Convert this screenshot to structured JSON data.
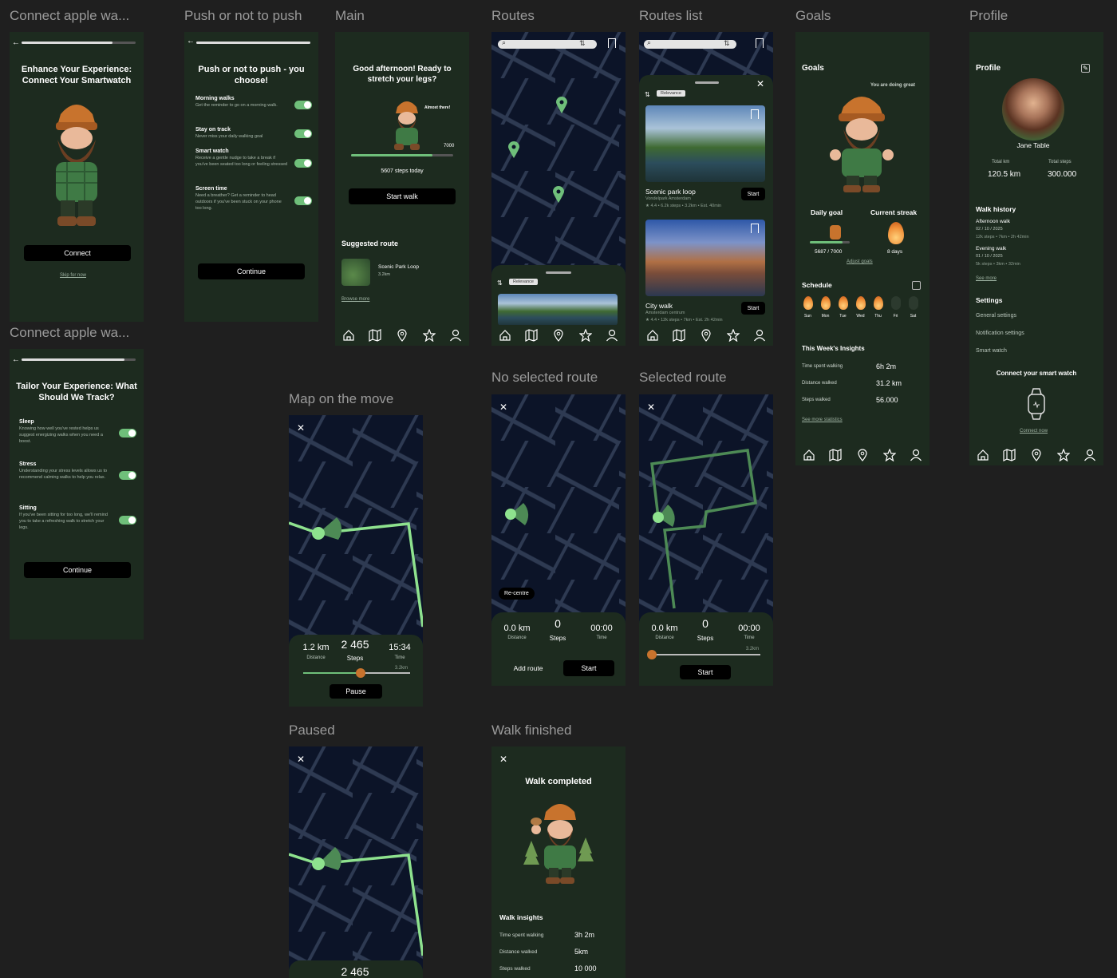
{
  "titles": {
    "connect1": "Connect apple wa...",
    "push": "Push or not to push",
    "main": "Main",
    "routes": "Routes",
    "routes_list": "Routes list",
    "goals": "Goals",
    "profile": "Profile",
    "connect2": "Connect apple wa...",
    "map_move": "Map on the move",
    "no_sel": "No selected route",
    "sel": "Selected route",
    "paused": "Paused",
    "finished": "Walk finished"
  },
  "connect1": {
    "heading": "Enhance Your Experience: Connect Your Smartwatch",
    "button": "Connect",
    "skip": "Skip for now",
    "progress": 0.8
  },
  "push": {
    "heading": "Push or not to push - you choose!",
    "options": [
      {
        "title": "Morning walks",
        "desc": "Get the reminder to go on a morning walk."
      },
      {
        "title": "Stay on track",
        "desc": "Never miss your daily walking goal"
      },
      {
        "title": "Smart watch",
        "desc": "Receive a gentle nudge to take a break if you've been seated too long or feeling stressed"
      },
      {
        "title": "Screen time",
        "desc": "Need a breather? Get a reminder to head outdoors if you've been stuck on your phone too long."
      }
    ],
    "button": "Continue",
    "progress": 1.0
  },
  "main": {
    "heading": "Good afternoon! Ready to stretch your legs?",
    "bubble": "Almost there!",
    "goal": "7000",
    "steps_today": "5607 steps today",
    "button": "Start walk",
    "suggested": "Suggested route",
    "route_name": "Scenic Park Loop",
    "route_dist": "3.2km",
    "browse": "Browse more",
    "progress": 0.8
  },
  "routes": {
    "filter": "Relevance"
  },
  "routes_list": {
    "filter": "Relevance",
    "cards": [
      {
        "name": "Scenic park loop",
        "place": "Vondelpark Amsterdam",
        "meta": "★ 4.4 • 6.2k steps • 3.2km • Est. 40min",
        "button": "Start"
      },
      {
        "name": "City walk",
        "place": "Amsterdam centrum",
        "meta": "★ 4.4 • 12k steps • 7km • Est. 2h 42min",
        "button": "Start"
      }
    ]
  },
  "goals": {
    "title": "Goals",
    "bubble": "You are doing great",
    "daily_goal": "Daily goal",
    "daily_val": "5687 / 7000",
    "adjust": "Adjust goals",
    "streak": "Current streak",
    "streak_val": "8 days",
    "schedule": "Schedule",
    "days": [
      "Sun",
      "Mon",
      "Tue",
      "Wed",
      "Thu",
      "Fri",
      "Sat"
    ],
    "insights": "This Week's Insights",
    "rows": [
      {
        "k": "Time spent walking",
        "v": "6h 2m"
      },
      {
        "k": "Distance walked",
        "v": "31.2 km"
      },
      {
        "k": "Steps walked",
        "v": "56.000"
      }
    ],
    "more": "See more statistics"
  },
  "profile": {
    "title": "Profile",
    "name": "Jane Table",
    "km_label": "Total km",
    "km": "120.5 km",
    "steps_label": "Total steps",
    "steps": "300.000",
    "history": "Walk history",
    "walks": [
      {
        "name": "Afternoon walk",
        "date": "02 / 10 / 2025",
        "meta": "12k steps • 7km • 2h 42min"
      },
      {
        "name": "Evening walk",
        "date": "01 / 10 / 2025",
        "meta": "5k steps • 3km • 32min"
      }
    ],
    "see_more": "See more",
    "settings": "Settings",
    "items": [
      "General settings",
      "Notification settings",
      "Smart watch"
    ],
    "connect": "Connect your smart watch",
    "connect_now": "Connect now"
  },
  "connect2": {
    "heading": "Tailor Your Experience: What Should We Track?",
    "options": [
      {
        "title": "Sleep",
        "desc": "Knowing how well you've rested helps us suggest energizing walks when you need a boost."
      },
      {
        "title": "Stress",
        "desc": "Understanding your stress levels allows us to recommend calming walks to help you relax."
      },
      {
        "title": "Sitting",
        "desc": "If you've been sitting for too long, we'll remind you to take a refreshing walk to stretch your legs."
      }
    ],
    "button": "Continue",
    "progress": 0.9
  },
  "move": {
    "km": "1.2 km",
    "km_l": "Distance",
    "steps": "2 465",
    "steps_l": "Steps",
    "time": "15:34",
    "time_l": "Time",
    "total": "3.2km",
    "button": "Pause"
  },
  "nosel": {
    "recentre": "Re-centre",
    "km": "0.0 km",
    "km_l": "Distance",
    "steps": "0",
    "steps_l": "Steps",
    "time": "00:00",
    "time_l": "Time",
    "add": "Add route",
    "start": "Start"
  },
  "sel": {
    "km": "0.0 km",
    "km_l": "Distance",
    "steps": "0",
    "steps_l": "Steps",
    "time": "00:00",
    "time_l": "Time",
    "total": "3.2km",
    "start": "Start"
  },
  "paused": {
    "steps": "2 465"
  },
  "finished": {
    "heading": "Walk completed",
    "insights": "Walk insights",
    "rows": [
      {
        "k": "Time spent walking",
        "v": "3h 2m"
      },
      {
        "k": "Distance walked",
        "v": "5km"
      },
      {
        "k": "Steps walked",
        "v": "10 000"
      }
    ]
  }
}
